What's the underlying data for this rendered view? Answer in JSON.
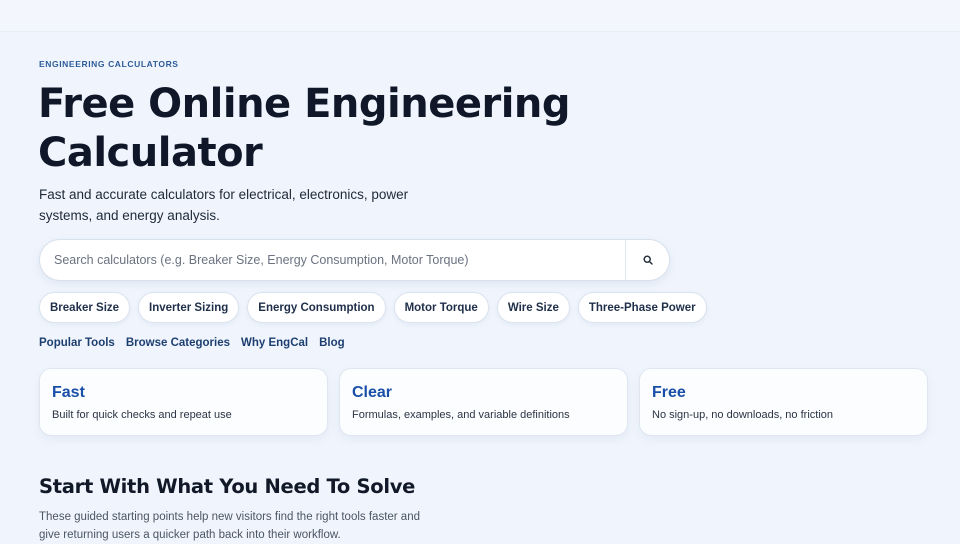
{
  "hero": {
    "eyebrow": "ENGINEERING CALCULATORS",
    "title": "Free Online Engineering Calculator",
    "subtitle": "Fast and accurate calculators for electrical, electronics, power systems, and energy analysis."
  },
  "search": {
    "placeholder": "Search calculators (e.g. Breaker Size, Energy Consumption, Motor Torque)",
    "button_icon": "search-icon"
  },
  "chips": [
    "Breaker Size",
    "Inverter Sizing",
    "Energy Consumption",
    "Motor Torque",
    "Wire Size",
    "Three-Phase Power"
  ],
  "nav": [
    "Popular Tools",
    "Browse Categories",
    "Why EngCal",
    "Blog"
  ],
  "features": [
    {
      "title": "Fast",
      "desc": "Built for quick checks and repeat use"
    },
    {
      "title": "Clear",
      "desc": "Formulas, examples, and variable definitions"
    },
    {
      "title": "Free",
      "desc": "No sign-up, no downloads, no friction"
    }
  ],
  "section": {
    "title": "Start With What You Need To Solve",
    "desc": "These guided starting points help new visitors find the right tools faster and give returning users a quicker path back into their workflow."
  },
  "colors": {
    "background": "#f0f5fd",
    "accent": "#1a4fa8",
    "nav_link": "#1d3f70"
  }
}
